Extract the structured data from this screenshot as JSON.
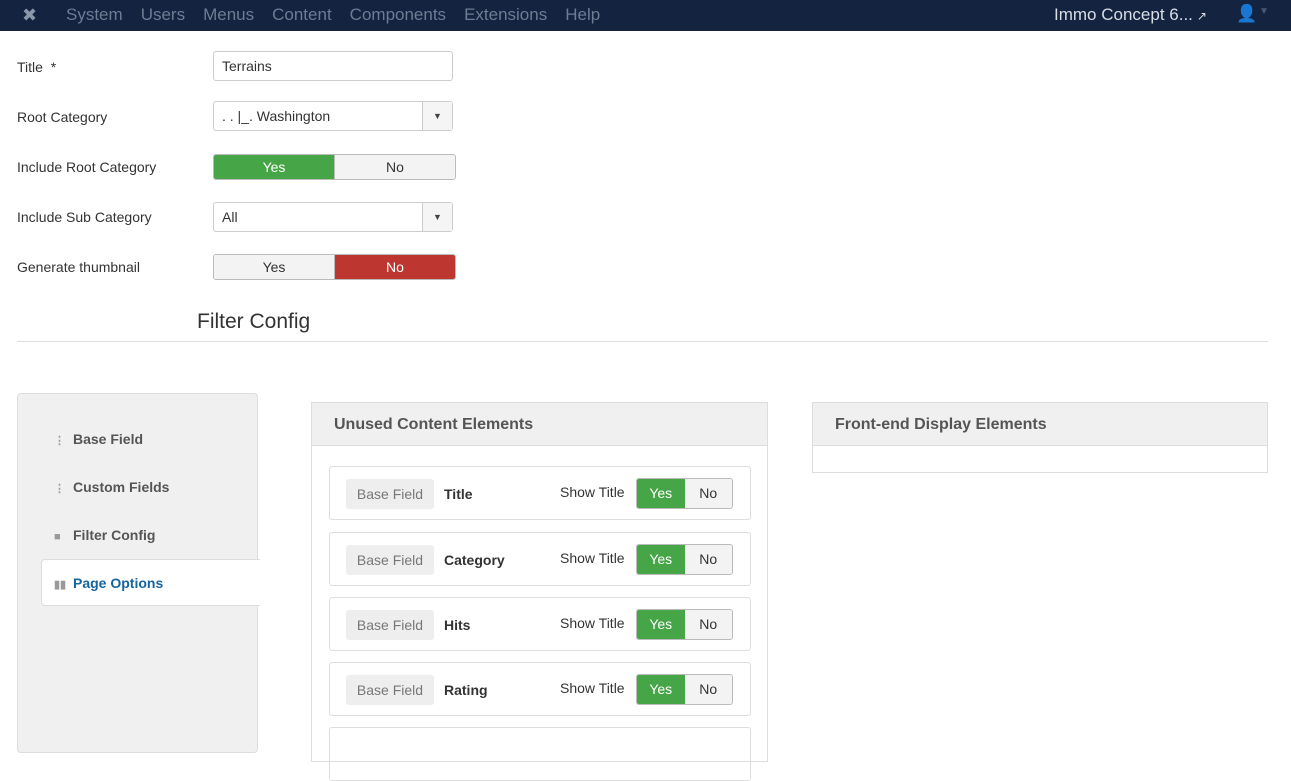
{
  "nav": {
    "menu": [
      "System",
      "Users",
      "Menus",
      "Content",
      "Components",
      "Extensions",
      "Help"
    ],
    "site": "Immo Concept 6..."
  },
  "form": {
    "title_label": "Title",
    "required": "*",
    "title_value": "Terrains",
    "root_label": "Root Category",
    "root_value": ". .  |_. Washington",
    "include_root_label": "Include Root Category",
    "include_sub_label": "Include Sub Category",
    "include_sub_value": "All",
    "thumb_label": "Generate thumbnail",
    "yes": "Yes",
    "no": "No"
  },
  "section_title": "Filter Config",
  "tabs": [
    "Base Field",
    "Custom Fields",
    "Filter Config",
    "Page Options"
  ],
  "unused": {
    "title": "Unused Content Elements",
    "rows": [
      {
        "type": "Base Field",
        "name": "Title",
        "show": "Show Title",
        "yes": "Yes",
        "no": "No"
      },
      {
        "type": "Base Field",
        "name": "Category",
        "show": "Show Title",
        "yes": "Yes",
        "no": "No"
      },
      {
        "type": "Base Field",
        "name": "Hits",
        "show": "Show Title",
        "yes": "Yes",
        "no": "No"
      },
      {
        "type": "Base Field",
        "name": "Rating",
        "show": "Show Title",
        "yes": "Yes",
        "no": "No"
      }
    ]
  },
  "frontend": {
    "title": "Front-end Display Elements"
  }
}
